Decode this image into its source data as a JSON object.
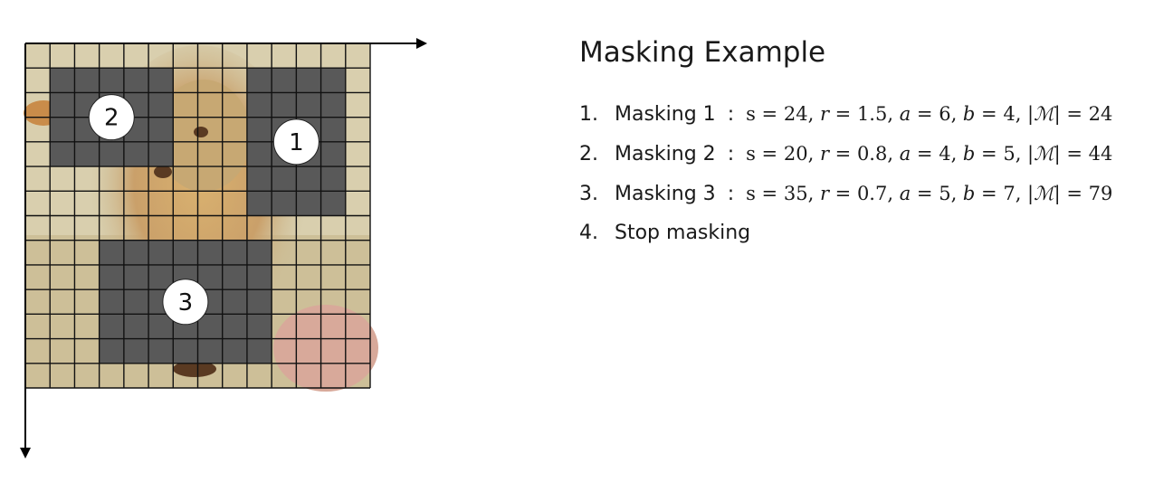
{
  "figure": {
    "grid": {
      "rows": 14,
      "cols": 14
    },
    "background_colors": {
      "cream": "#d9cfae",
      "beige": "#cdbf98",
      "tan": "#c7a873",
      "orange": "#c98c4a",
      "pink": "#d8a99a",
      "dark_brown": "#5a3a22"
    },
    "mask_color": "#595959",
    "grid_line_color": "#111111",
    "masks": [
      {
        "label": "1",
        "row_start": 1,
        "row_end": 6,
        "col_start": 9,
        "col_end": 12
      },
      {
        "label": "2",
        "row_start": 1,
        "row_end": 4,
        "col_start": 1,
        "col_end": 5
      },
      {
        "label": "3",
        "row_start": 8,
        "row_end": 12,
        "col_start": 3,
        "col_end": 9
      }
    ]
  },
  "panel": {
    "title": "Masking Example",
    "separator": ":",
    "steps": [
      {
        "number": "1.",
        "label": "Masking 1",
        "math": {
          "s": "24",
          "r": "1.5",
          "a": "6",
          "b": "4",
          "M": "24"
        }
      },
      {
        "number": "2.",
        "label": "Masking 2",
        "math": {
          "s": "20",
          "r": "0.8",
          "a": "4",
          "b": "5",
          "M": "44"
        }
      },
      {
        "number": "3.",
        "label": "Masking 3",
        "math": {
          "s": "35",
          "r": "0.7",
          "a": "5",
          "b": "7",
          "M": "79"
        }
      },
      {
        "number": "4.",
        "label": "Stop masking"
      }
    ]
  }
}
